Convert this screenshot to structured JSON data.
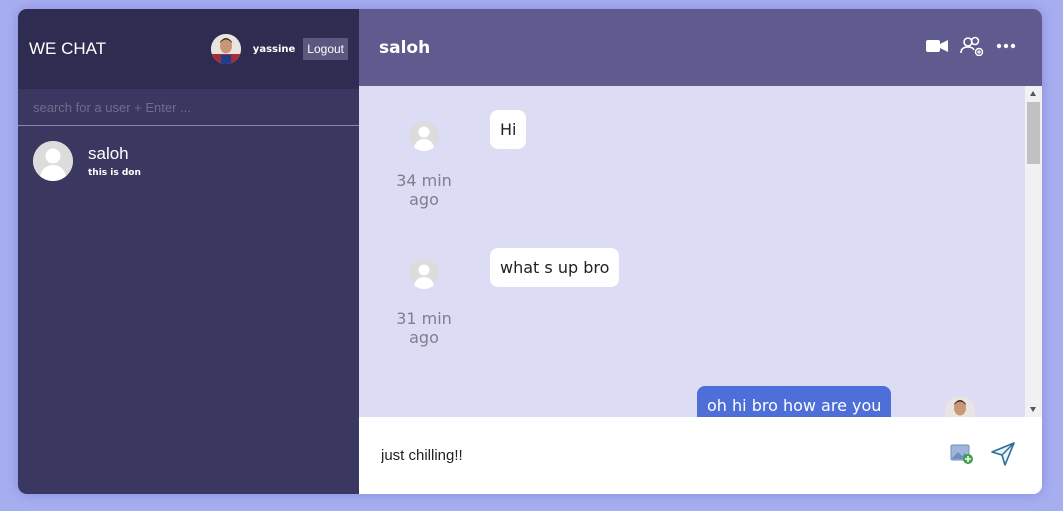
{
  "app": {
    "brand": "WE CHAT"
  },
  "user": {
    "name": "yassine",
    "logout_label": "Logout"
  },
  "search": {
    "placeholder": "search for a user + Enter ..."
  },
  "contacts": [
    {
      "name": "saloh",
      "status": "this is don"
    }
  ],
  "chat": {
    "title": "saloh",
    "header_icons": [
      "video-camera-icon",
      "group-add-icon",
      "more-options-icon"
    ],
    "messages": [
      {
        "text": "Hi",
        "time": "34 min ago",
        "from": "other"
      },
      {
        "text": "what s up bro",
        "time": "31 min ago",
        "from": "other"
      },
      {
        "text": "oh hi bro how are you",
        "time": "",
        "from": "me"
      }
    ]
  },
  "composer": {
    "value": "just chilling!!",
    "icons": [
      "add-image-icon",
      "send-icon"
    ]
  },
  "colors": {
    "sidebar": "#3a3760",
    "sidebar_header": "#2f2c52",
    "chat_header": "#5f5b8e",
    "chat_bg": "#dddcf5",
    "my_bubble": "#4e6ed8",
    "page_bg": "#a7aef0"
  }
}
